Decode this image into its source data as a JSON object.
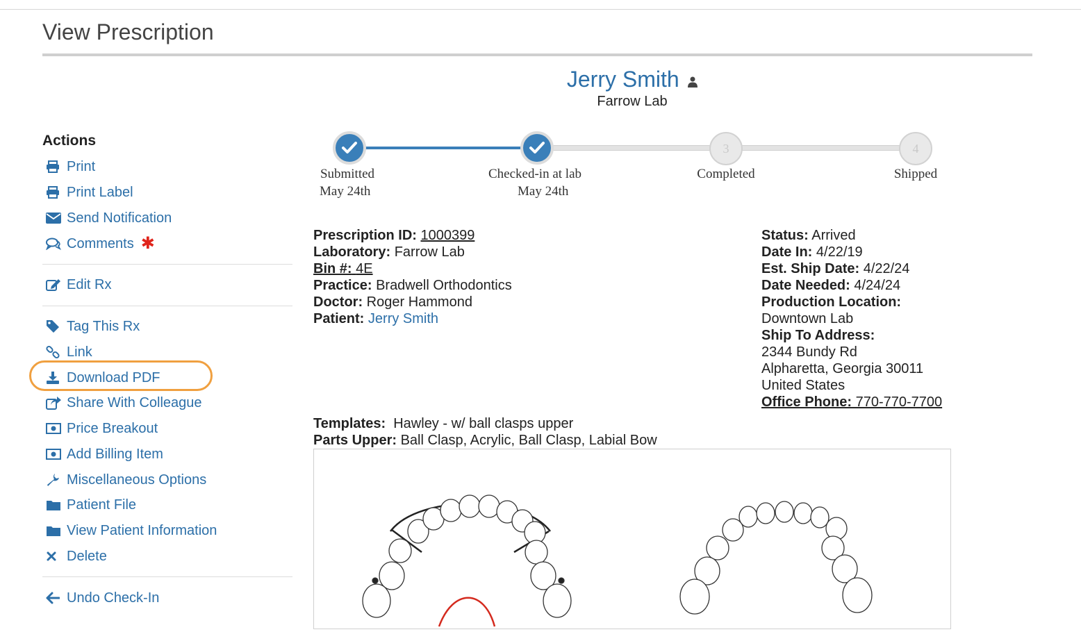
{
  "page": {
    "title": "View Prescription"
  },
  "patient_header": {
    "name": "Jerry Smith",
    "lab": "Farrow Lab"
  },
  "actions": {
    "heading": "Actions",
    "items": [
      {
        "label": "Print",
        "icon": "printer-icon"
      },
      {
        "label": "Print Label",
        "icon": "printer-icon"
      },
      {
        "label": "Send Notification",
        "icon": "envelope-icon"
      },
      {
        "label": "Comments",
        "icon": "comments-icon",
        "required_marker": "✱"
      },
      {
        "label": "Edit Rx",
        "icon": "edit-icon"
      },
      {
        "label": "Tag This Rx",
        "icon": "tag-icon"
      },
      {
        "label": "Link",
        "icon": "link-icon"
      },
      {
        "label": "Download PDF",
        "icon": "download-icon",
        "highlighted": true
      },
      {
        "label": "Share With Colleague",
        "icon": "share-icon"
      },
      {
        "label": "Price Breakout",
        "icon": "money-icon"
      },
      {
        "label": "Add Billing Item",
        "icon": "money-icon"
      },
      {
        "label": "Miscellaneous Options",
        "icon": "wrench-icon"
      },
      {
        "label": "Patient File",
        "icon": "folder-icon"
      },
      {
        "label": "View Patient Information",
        "icon": "folder-icon"
      },
      {
        "label": "Delete",
        "icon": "close-icon"
      },
      {
        "label": "Undo Check-In",
        "icon": "arrow-left-icon"
      }
    ]
  },
  "progress": {
    "steps": [
      {
        "label": "Submitted",
        "date": "May 24th",
        "done": true
      },
      {
        "label": "Checked-in at lab",
        "date": "May 24th",
        "done": true
      },
      {
        "label": "Completed",
        "number": "3",
        "done": false
      },
      {
        "label": "Shipped",
        "number": "4",
        "done": false
      }
    ]
  },
  "details_left": {
    "prescription_id_label": "Prescription ID:",
    "prescription_id": "1000399",
    "laboratory_label": "Laboratory:",
    "laboratory": "Farrow Lab",
    "bin_label": "Bin #:",
    "bin": "4E",
    "practice_label": "Practice:",
    "practice": "Bradwell Orthodontics",
    "doctor_label": "Doctor:",
    "doctor": "Roger Hammond",
    "patient_label": "Patient:",
    "patient": "Jerry Smith"
  },
  "details_right": {
    "status_label": "Status:",
    "status": "Arrived",
    "date_in_label": "Date In:",
    "date_in": "4/22/19",
    "est_ship_label": "Est. Ship Date:",
    "est_ship": "4/22/24",
    "date_needed_label": "Date Needed:",
    "date_needed": "4/24/24",
    "production_location_label": "Production Location:",
    "production_location": "Downtown Lab",
    "ship_to_label": "Ship To Address:",
    "address_line1": "2344 Bundy Rd",
    "address_line2": "Alpharetta, Georgia 30011",
    "address_line3": "United States",
    "office_phone_label": "Office Phone:",
    "office_phone": " 770-770-7700"
  },
  "templates": {
    "templates_label": "Templates:",
    "templates_value": "Hawley - w/ ball clasps upper",
    "parts_upper_label": "Parts Upper:",
    "parts_upper_value": "Ball Clasp, Acrylic, Ball Clasp, Labial Bow"
  },
  "colors": {
    "link": "#2c6fa8",
    "progress_done": "#3a7fb9",
    "highlight": "#f0a040",
    "required": "#e0241b"
  }
}
